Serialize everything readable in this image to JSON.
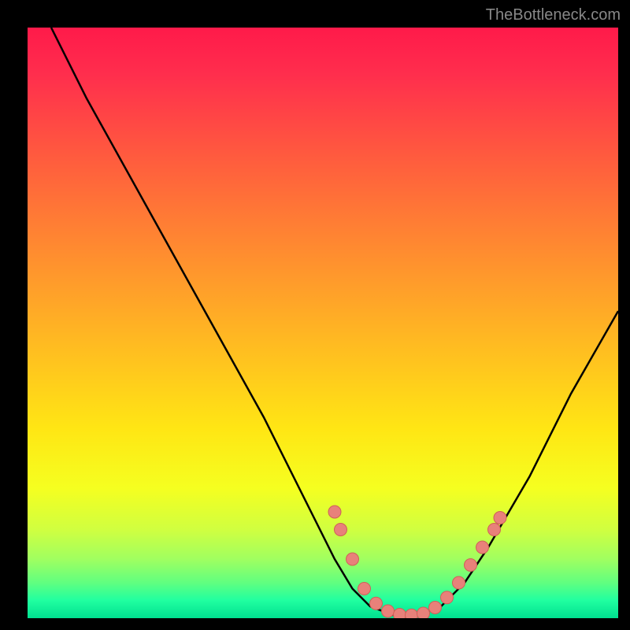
{
  "watermark": "TheBottleneck.com",
  "chart_data": {
    "type": "line",
    "title": "",
    "xlabel": "",
    "ylabel": "",
    "xlim": [
      0,
      100
    ],
    "ylim": [
      0,
      100
    ],
    "curve": [
      {
        "x": 4,
        "y": 100
      },
      {
        "x": 10,
        "y": 88
      },
      {
        "x": 20,
        "y": 70
      },
      {
        "x": 30,
        "y": 52
      },
      {
        "x": 40,
        "y": 34
      },
      {
        "x": 48,
        "y": 18
      },
      {
        "x": 52,
        "y": 10
      },
      {
        "x": 55,
        "y": 5
      },
      {
        "x": 58,
        "y": 2
      },
      {
        "x": 62,
        "y": 0.5
      },
      {
        "x": 66,
        "y": 0.5
      },
      {
        "x": 70,
        "y": 2
      },
      {
        "x": 74,
        "y": 6
      },
      {
        "x": 78,
        "y": 12
      },
      {
        "x": 85,
        "y": 24
      },
      {
        "x": 92,
        "y": 38
      },
      {
        "x": 100,
        "y": 52
      }
    ],
    "highlight_dots": [
      {
        "x": 52,
        "y": 18
      },
      {
        "x": 53,
        "y": 15
      },
      {
        "x": 55,
        "y": 10
      },
      {
        "x": 57,
        "y": 5
      },
      {
        "x": 59,
        "y": 2.5
      },
      {
        "x": 61,
        "y": 1.2
      },
      {
        "x": 63,
        "y": 0.6
      },
      {
        "x": 65,
        "y": 0.5
      },
      {
        "x": 67,
        "y": 0.8
      },
      {
        "x": 69,
        "y": 1.8
      },
      {
        "x": 71,
        "y": 3.5
      },
      {
        "x": 73,
        "y": 6
      },
      {
        "x": 75,
        "y": 9
      },
      {
        "x": 77,
        "y": 12
      },
      {
        "x": 79,
        "y": 15
      },
      {
        "x": 80,
        "y": 17
      }
    ]
  }
}
